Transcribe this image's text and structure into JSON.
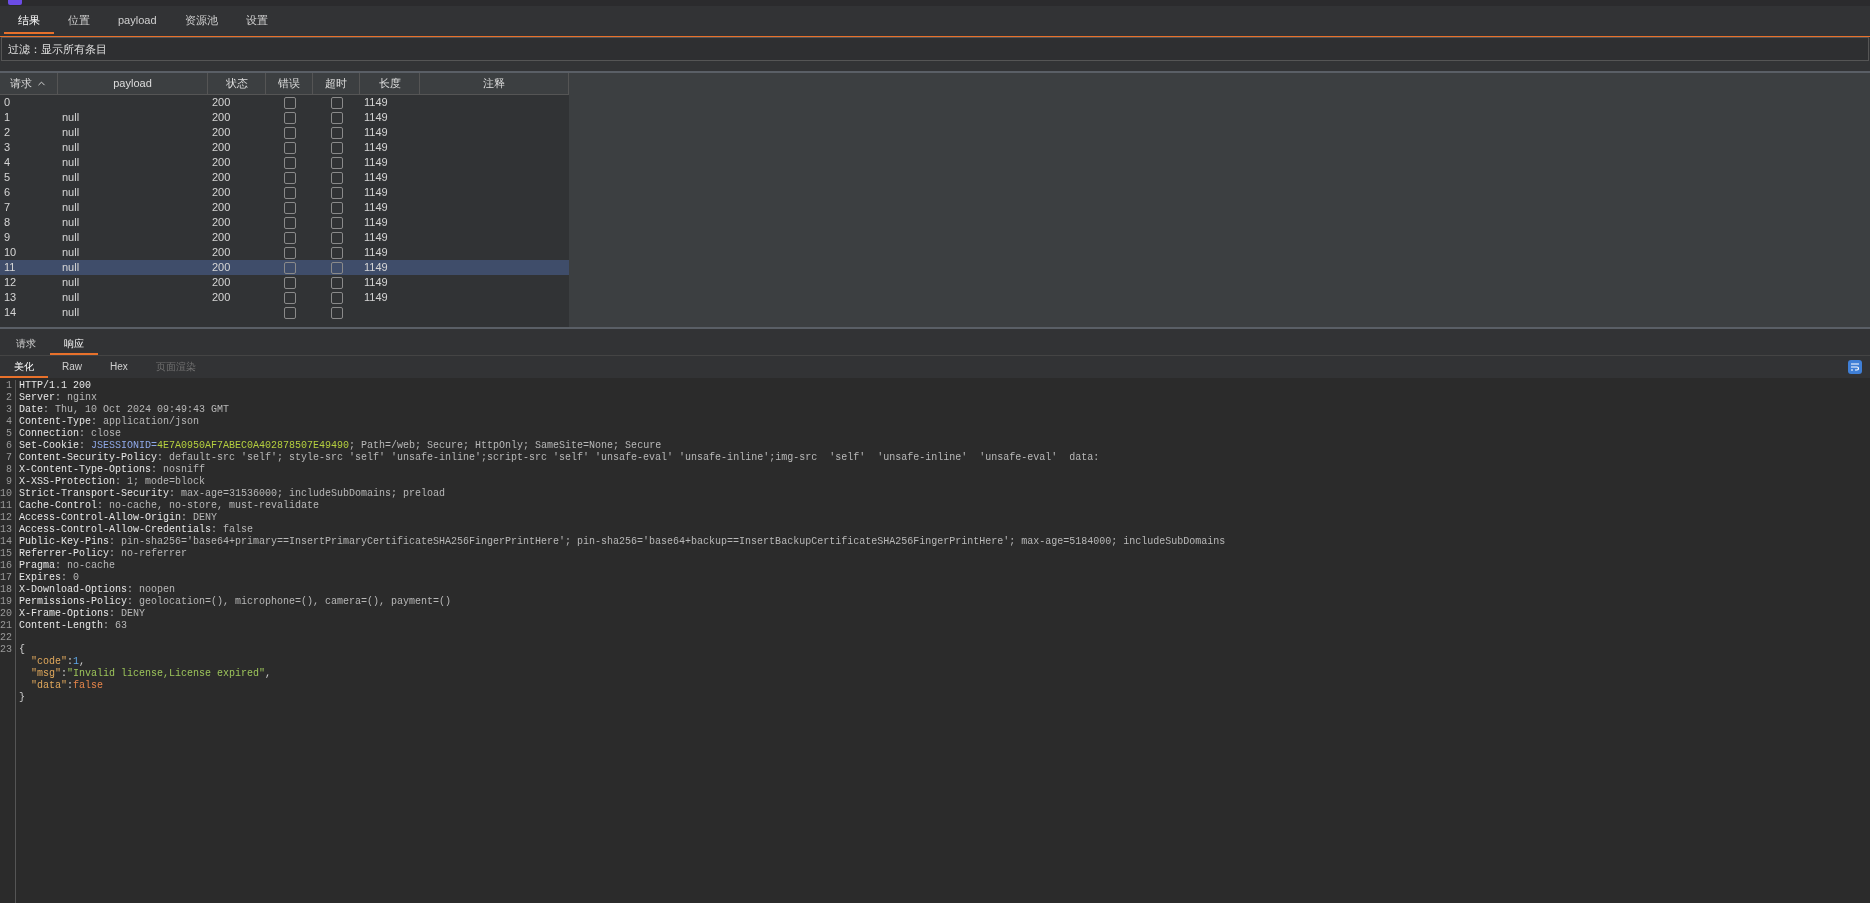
{
  "tabs": [
    {
      "label": "结果",
      "selected": true
    },
    {
      "label": "位置",
      "selected": false
    },
    {
      "label": "payload",
      "selected": false
    },
    {
      "label": "资源池",
      "selected": false
    },
    {
      "label": "设置",
      "selected": false
    }
  ],
  "filter": {
    "value": "过滤：显示所有条目"
  },
  "table": {
    "columns": [
      {
        "label": "请求",
        "sorted": true
      },
      {
        "label": "payload",
        "sorted": false
      },
      {
        "label": "状态",
        "sorted": false
      },
      {
        "label": "错误",
        "sorted": false
      },
      {
        "label": "超时",
        "sorted": false
      },
      {
        "label": "长度",
        "sorted": false
      },
      {
        "label": "注释",
        "sorted": false
      }
    ],
    "rows": [
      {
        "request": "0",
        "payload": "",
        "status": "200",
        "error": false,
        "timeout": false,
        "length": "1149",
        "selected": false
      },
      {
        "request": "1",
        "payload": "null",
        "status": "200",
        "error": false,
        "timeout": false,
        "length": "1149",
        "selected": false
      },
      {
        "request": "2",
        "payload": "null",
        "status": "200",
        "error": false,
        "timeout": false,
        "length": "1149",
        "selected": false
      },
      {
        "request": "3",
        "payload": "null",
        "status": "200",
        "error": false,
        "timeout": false,
        "length": "1149",
        "selected": false
      },
      {
        "request": "4",
        "payload": "null",
        "status": "200",
        "error": false,
        "timeout": false,
        "length": "1149",
        "selected": false
      },
      {
        "request": "5",
        "payload": "null",
        "status": "200",
        "error": false,
        "timeout": false,
        "length": "1149",
        "selected": false
      },
      {
        "request": "6",
        "payload": "null",
        "status": "200",
        "error": false,
        "timeout": false,
        "length": "1149",
        "selected": false
      },
      {
        "request": "7",
        "payload": "null",
        "status": "200",
        "error": false,
        "timeout": false,
        "length": "1149",
        "selected": false
      },
      {
        "request": "8",
        "payload": "null",
        "status": "200",
        "error": false,
        "timeout": false,
        "length": "1149",
        "selected": false
      },
      {
        "request": "9",
        "payload": "null",
        "status": "200",
        "error": false,
        "timeout": false,
        "length": "1149",
        "selected": false
      },
      {
        "request": "10",
        "payload": "null",
        "status": "200",
        "error": false,
        "timeout": false,
        "length": "1149",
        "selected": false
      },
      {
        "request": "11",
        "payload": "null",
        "status": "200",
        "error": false,
        "timeout": false,
        "length": "1149",
        "selected": true
      },
      {
        "request": "12",
        "payload": "null",
        "status": "200",
        "error": false,
        "timeout": false,
        "length": "1149",
        "selected": false
      },
      {
        "request": "13",
        "payload": "null",
        "status": "200",
        "error": false,
        "timeout": false,
        "length": "1149",
        "selected": false
      },
      {
        "request": "14",
        "payload": "null",
        "error": false,
        "timeout": false,
        "selected": false
      }
    ]
  },
  "message_tabs": [
    {
      "label": "请求",
      "selected": false
    },
    {
      "label": "响应",
      "selected": true
    }
  ],
  "view_tabs": [
    {
      "label": "美化",
      "selected": true,
      "disabled": false
    },
    {
      "label": "Raw",
      "selected": false,
      "disabled": false
    },
    {
      "label": "Hex",
      "selected": false,
      "disabled": false
    },
    {
      "label": "页面渲染",
      "selected": false,
      "disabled": true
    }
  ],
  "editor": {
    "lines": [
      {
        "number": "1",
        "segments": [
          {
            "kind": "plain",
            "text": "HTTP/1.1 200"
          }
        ]
      },
      {
        "number": "2",
        "segments": [
          {
            "kind": "name",
            "text": "Server"
          },
          {
            "kind": "value",
            "text": ": nginx"
          }
        ]
      },
      {
        "number": "3",
        "segments": [
          {
            "kind": "name",
            "text": "Date"
          },
          {
            "kind": "value",
            "text": ": Thu, 10 Oct 2024 09:49:43 GMT"
          }
        ]
      },
      {
        "number": "4",
        "segments": [
          {
            "kind": "name",
            "text": "Content-Type"
          },
          {
            "kind": "value",
            "text": ": application/json"
          }
        ]
      },
      {
        "number": "5",
        "segments": [
          {
            "kind": "name",
            "text": "Connection"
          },
          {
            "kind": "value",
            "text": ": close"
          }
        ]
      },
      {
        "number": "6",
        "segments": [
          {
            "kind": "name",
            "text": "Set-Cookie"
          },
          {
            "kind": "value",
            "text": ": "
          },
          {
            "kind": "cookie-name",
            "text": "JSESSIONID="
          },
          {
            "kind": "cookie-value",
            "text": "4E7A0950AF7ABEC0A402878507E49490"
          },
          {
            "kind": "value",
            "text": "; Path=/web; Secure; HttpOnly; SameSite=None; Secure"
          }
        ]
      },
      {
        "number": "7",
        "segments": [
          {
            "kind": "name",
            "text": "Content-Security-Policy"
          },
          {
            "kind": "value",
            "text": ": default-src 'self'; style-src 'self' 'unsafe-inline';script-src 'self' 'unsafe-eval' 'unsafe-inline';img-src  'self'  'unsafe-inline'  'unsafe-eval'  data:"
          }
        ]
      },
      {
        "number": "8",
        "segments": [
          {
            "kind": "name",
            "text": "X-Content-Type-Options"
          },
          {
            "kind": "value",
            "text": ": nosniff"
          }
        ]
      },
      {
        "number": "9",
        "segments": [
          {
            "kind": "name",
            "text": "X-XSS-Protection"
          },
          {
            "kind": "value",
            "text": ": 1; mode=block"
          }
        ]
      },
      {
        "number": "10",
        "segments": [
          {
            "kind": "name",
            "text": "Strict-Transport-Security"
          },
          {
            "kind": "value",
            "text": ": max-age=31536000; includeSubDomains; preload"
          }
        ]
      },
      {
        "number": "11",
        "segments": [
          {
            "kind": "name",
            "text": "Cache-Control"
          },
          {
            "kind": "value",
            "text": ": no-cache, no-store, must-revalidate"
          }
        ]
      },
      {
        "number": "12",
        "segments": [
          {
            "kind": "name",
            "text": "Access-Control-Allow-Origin"
          },
          {
            "kind": "value",
            "text": ": DENY"
          }
        ]
      },
      {
        "number": "13",
        "segments": [
          {
            "kind": "name",
            "text": "Access-Control-Allow-Credentials"
          },
          {
            "kind": "value",
            "text": ": false"
          }
        ]
      },
      {
        "number": "14",
        "segments": [
          {
            "kind": "name",
            "text": "Public-Key-Pins"
          },
          {
            "kind": "value",
            "text": ": pin-sha256='base64+primary==InsertPrimaryCertificateSHA256FingerPrintHere'; pin-sha256='base64+backup==InsertBackupCertificateSHA256FingerPrintHere'; max-age=5184000; includeSubDomains"
          }
        ]
      },
      {
        "number": "15",
        "segments": [
          {
            "kind": "name",
            "text": "Referrer-Policy"
          },
          {
            "kind": "value",
            "text": ": no-referrer"
          }
        ]
      },
      {
        "number": "16",
        "segments": [
          {
            "kind": "name",
            "text": "Pragma"
          },
          {
            "kind": "value",
            "text": ": no-cache"
          }
        ]
      },
      {
        "number": "17",
        "segments": [
          {
            "kind": "name",
            "text": "Expires"
          },
          {
            "kind": "value",
            "text": ": 0"
          }
        ]
      },
      {
        "number": "18",
        "segments": [
          {
            "kind": "name",
            "text": "X-Download-Options"
          },
          {
            "kind": "value",
            "text": ": noopen"
          }
        ]
      },
      {
        "number": "19",
        "segments": [
          {
            "kind": "name",
            "text": "Permissions-Policy"
          },
          {
            "kind": "value",
            "text": ": geolocation=(), microphone=(), camera=(), payment=()"
          }
        ]
      },
      {
        "number": "20",
        "segments": [
          {
            "kind": "name",
            "text": "X-Frame-Options"
          },
          {
            "kind": "value",
            "text": ": DENY"
          }
        ]
      },
      {
        "number": "21",
        "segments": [
          {
            "kind": "name",
            "text": "Content-Length"
          },
          {
            "kind": "value",
            "text": ": 63"
          }
        ]
      },
      {
        "number": "22"
      },
      {
        "number": "23",
        "segments": [
          {
            "kind": "punct",
            "text": "{"
          }
        ]
      },
      {
        "indent": true,
        "segments": [
          {
            "kind": "json-key",
            "text": "\"code\""
          },
          {
            "kind": "punct",
            "text": ":"
          },
          {
            "kind": "json-number",
            "text": "1"
          },
          {
            "kind": "punct",
            "text": ","
          }
        ]
      },
      {
        "indent": true,
        "segments": [
          {
            "kind": "json-key",
            "text": "\"msg\""
          },
          {
            "kind": "punct",
            "text": ":"
          },
          {
            "kind": "json-string",
            "text": "\"Invalid license,License expired\""
          },
          {
            "kind": "punct",
            "text": ","
          }
        ]
      },
      {
        "indent": true,
        "segments": [
          {
            "kind": "json-key",
            "text": "\"data\""
          },
          {
            "kind": "punct",
            "text": ":"
          },
          {
            "kind": "json-bool",
            "text": "false"
          }
        ]
      },
      {
        "segments": [
          {
            "kind": "punct",
            "text": "}"
          }
        ]
      }
    ]
  }
}
